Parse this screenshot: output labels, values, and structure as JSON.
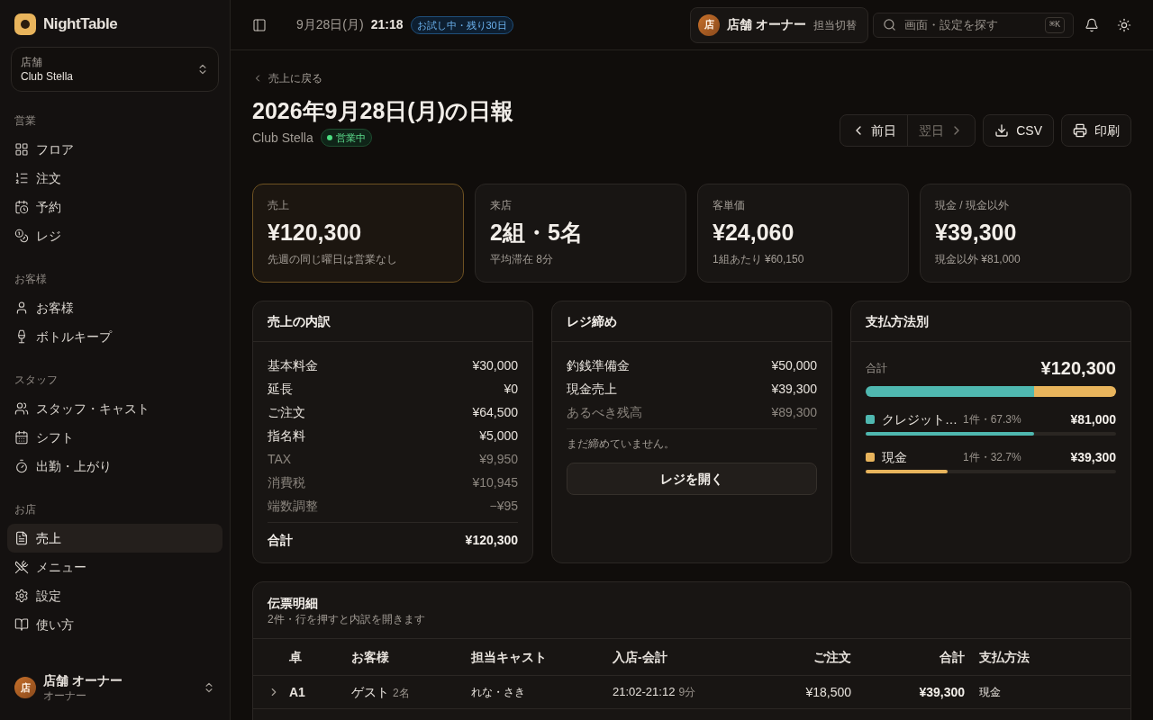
{
  "brand": {
    "name": "NightTable"
  },
  "store_switcher": {
    "label": "店舗",
    "value": "Club Stella"
  },
  "nav_sections": [
    {
      "title": "営業",
      "items": [
        {
          "label": "フロア",
          "selected": false
        },
        {
          "label": "注文",
          "selected": false
        },
        {
          "label": "予約",
          "selected": false
        },
        {
          "label": "レジ",
          "selected": false
        }
      ]
    },
    {
      "title": "お客様",
      "items": [
        {
          "label": "お客様",
          "selected": false
        },
        {
          "label": "ボトルキープ",
          "selected": false
        }
      ]
    },
    {
      "title": "スタッフ",
      "items": [
        {
          "label": "スタッフ・キャスト",
          "selected": false
        },
        {
          "label": "シフト",
          "selected": false
        },
        {
          "label": "出勤・上がり",
          "selected": false
        }
      ]
    },
    {
      "title": "お店",
      "items": [
        {
          "label": "売上",
          "selected": true
        },
        {
          "label": "メニュー",
          "selected": false
        },
        {
          "label": "設定",
          "selected": false
        },
        {
          "label": "使い方",
          "selected": false
        }
      ]
    }
  ],
  "user": {
    "avatar": "店",
    "name": "店舗 オーナー",
    "role": "オーナー"
  },
  "header": {
    "date": "9月28日(月)",
    "time": "21:18",
    "trial_badge": "お試し中・残り30日",
    "account": {
      "avatar": "店",
      "name": "店舗 オーナー",
      "switch_label": "担当切替"
    },
    "search": {
      "placeholder": "画面・設定を探す",
      "shortcut": "⌘K"
    }
  },
  "page": {
    "back_link": "売上に戻る",
    "title": "2026年9月28日(月)の日報",
    "store": "Club Stella",
    "status": "営業中",
    "prev_day": {
      "label": "前日",
      "disabled": false
    },
    "next_day": {
      "label": "翌日",
      "disabled": true
    },
    "csv": "CSV",
    "print": "印刷"
  },
  "kpis": [
    {
      "label": "売上",
      "value": "¥120,300",
      "note": "先週の同じ曜日は営業なし",
      "highlighted": true
    },
    {
      "label": "来店",
      "value": "2組・5名",
      "note": "平均滞在 8分",
      "highlighted": false
    },
    {
      "label": "客単価",
      "value": "¥24,060",
      "note": "1組あたり ¥60,150",
      "highlighted": false
    },
    {
      "label": "現金 / 現金以外",
      "value": "¥39,300",
      "note": "現金以外 ¥81,000",
      "highlighted": false
    }
  ],
  "breakdown": {
    "title": "売上の内訳",
    "rows": [
      {
        "label": "基本料金",
        "value": "¥30,000",
        "muted": false
      },
      {
        "label": "延長",
        "value": "¥0",
        "muted": false
      },
      {
        "label": "ご注文",
        "value": "¥64,500",
        "muted": false
      },
      {
        "label": "指名料",
        "value": "¥5,000",
        "muted": false
      },
      {
        "label": "TAX",
        "value": "¥9,950",
        "muted": true
      },
      {
        "label": "消費税",
        "value": "¥10,945",
        "muted": true
      },
      {
        "label": "端数調整",
        "value": "−¥95",
        "muted": true
      }
    ],
    "total": {
      "label": "合計",
      "value": "¥120,300"
    }
  },
  "register": {
    "title": "レジ締め",
    "rows": [
      {
        "label": "釣銭準備金",
        "value": "¥50,000",
        "muted": false
      },
      {
        "label": "現金売上",
        "value": "¥39,300",
        "muted": false
      },
      {
        "label": "あるべき残高",
        "value": "¥89,300",
        "muted": true
      }
    ],
    "note": "まだ締めていません。",
    "button": "レジを開く"
  },
  "payments": {
    "title": "支払方法別",
    "total_label": "合計",
    "total": "¥120,300",
    "methods": [
      {
        "name": "クレジット…",
        "detail": "1件・67.3%",
        "amount": "¥81,000",
        "color": "#4fb8b0",
        "level": 0.673
      },
      {
        "name": "現金",
        "detail": "1件・32.7%",
        "amount": "¥39,300",
        "color": "#e8b45c",
        "level": 0.327
      }
    ]
  },
  "slips": {
    "title": "伝票明細",
    "subtitle": "2件・行を押すと内訳を開きます",
    "columns": [
      "卓",
      "お客様",
      "担当キャスト",
      "入店-会計",
      "ご注文",
      "合計",
      "支払方法"
    ],
    "rows": [
      {
        "table": "A1",
        "guest": "ゲスト",
        "party": "2名",
        "cast": "れな・さき",
        "time": "21:02-21:12",
        "stay": "9分",
        "order": "¥18,500",
        "total": "¥39,300",
        "payment": "現金",
        "expanded": false
      }
    ]
  }
}
